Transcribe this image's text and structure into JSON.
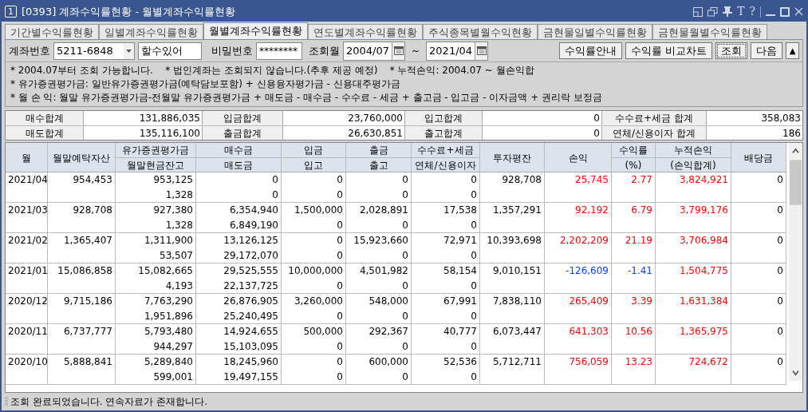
{
  "window": {
    "badge": "1",
    "title": "[0393] 계좌수익률현황 - 월별계좌수익률현황",
    "tool_glyphs": [
      "T",
      "?"
    ]
  },
  "tabs": [
    {
      "label": "기간별수익률현황",
      "selected": false
    },
    {
      "label": "일별계좌수익률현황",
      "selected": false
    },
    {
      "label": "월별계좌수익률현황",
      "selected": true
    },
    {
      "label": "연도별계좌수익률현황",
      "selected": false
    },
    {
      "label": "주식종목별월수익현황",
      "selected": false
    },
    {
      "label": "금현물일별수익률현황",
      "selected": false
    },
    {
      "label": "금현물월별수익률현황",
      "selected": false
    }
  ],
  "query": {
    "account_label": "계좌번호",
    "account": "5211-6848",
    "account_name": "할수있어",
    "password_label": "비밀번호",
    "password": "********",
    "period_label": "조회월",
    "from": "2004/07",
    "separator": "~",
    "to": "2021/04",
    "buttons": [
      {
        "label": "수익률안내",
        "focused": false
      },
      {
        "label": "수익률 비교차트",
        "focused": false
      },
      {
        "label": "조회",
        "focused": true
      },
      {
        "label": "다음",
        "focused": false
      }
    ],
    "collapse": "▲"
  },
  "notes": [
    "* 2004.07부터 조회 가능합니다.    * 법인계좌는 조회되지 않습니다.(추후 제공 예정)    * 누적손익: 2004.07 ~ 월손익합",
    "* 유가증권평가금: 일반유가증권평가금(예탁담보포함) + 신용융자평가금 - 신용대주평가금",
    "* 월 손 익: 월말 유가증권평가금-전월말 유가증권평가금 + 매도금 - 매수금 - 수수료 - 세금 + 출고금 - 입고금 - 이자금액 + 권리락 보정금"
  ],
  "summary": [
    [
      {
        "label": "매수합계",
        "value": "131,886,035"
      },
      {
        "label": "입금합계",
        "value": "23,760,000"
      },
      {
        "label": "입고합계",
        "value": "0"
      },
      {
        "label": "수수료+세금 합계",
        "value": "358,083"
      }
    ],
    [
      {
        "label": "매도합계",
        "value": "135,116,100"
      },
      {
        "label": "출금합계",
        "value": "26,630,851"
      },
      {
        "label": "출고합계",
        "value": "0"
      },
      {
        "label": "연체/신용이자 합계",
        "value": "186"
      }
    ]
  ],
  "table": {
    "columns": [
      {
        "top": "월"
      },
      {
        "top": "월말예탁자산"
      },
      {
        "top": "유가증권평가금",
        "bottom": "월말현금잔고"
      },
      {
        "top": "매수금",
        "bottom": "매도금"
      },
      {
        "top": "입금",
        "bottom": "입고"
      },
      {
        "top": "출금",
        "bottom": "출고"
      },
      {
        "top": "수수료+세금",
        "bottom": "연체/신용이자"
      },
      {
        "top": "투자평잔"
      },
      {
        "top": "손익"
      },
      {
        "top": "수익률",
        "bottom": "(%)"
      },
      {
        "top": "누적손익",
        "bottom": "(손익합계)"
      },
      {
        "top": "배당금"
      }
    ],
    "rows": [
      {
        "month": "2021/04",
        "assets": "954,453",
        "securities": "953,125",
        "cash": "1,328",
        "buy": "0",
        "sell": "0",
        "deposit": "0",
        "stock_in": "0",
        "withdrawal": "0",
        "stock_out": "0",
        "fee_tax": "0",
        "interest": "0",
        "avg_investment": "928,708",
        "profit": "25,745",
        "rate": "2.77",
        "cumulative": "3,824,921",
        "dividend": "0",
        "color": "#ff0000"
      },
      {
        "month": "2021/03",
        "assets": "928,708",
        "securities": "927,380",
        "cash": "1,328",
        "buy": "6,354,940",
        "sell": "6,849,190",
        "deposit": "1,500,000",
        "stock_in": "0",
        "withdrawal": "2,028,891",
        "stock_out": "0",
        "fee_tax": "17,538",
        "interest": "0",
        "avg_investment": "1,357,291",
        "profit": "92,192",
        "rate": "6.79",
        "cumulative": "3,799,176",
        "dividend": "0",
        "color": "#ff0000"
      },
      {
        "month": "2021/02",
        "assets": "1,365,407",
        "securities": "1,311,900",
        "cash": "53,507",
        "buy": "13,126,125",
        "sell": "29,172,070",
        "deposit": "0",
        "stock_in": "0",
        "withdrawal": "15,923,660",
        "stock_out": "0",
        "fee_tax": "72,971",
        "interest": "0",
        "avg_investment": "10,393,698",
        "profit": "2,202,209",
        "rate": "21.19",
        "cumulative": "3,706,984",
        "dividend": "0",
        "color": "#ff0000"
      },
      {
        "month": "2021/01",
        "assets": "15,086,858",
        "securities": "15,082,665",
        "cash": "4,193",
        "buy": "29,525,555",
        "sell": "22,137,725",
        "deposit": "10,000,000",
        "stock_in": "0",
        "withdrawal": "4,501,982",
        "stock_out": "0",
        "fee_tax": "58,154",
        "interest": "0",
        "avg_investment": "9,010,151",
        "profit": "-126,609",
        "rate": "-1.41",
        "cumulative": "1,504,775",
        "dividend": "0",
        "color": "#0040ff"
      },
      {
        "month": "2020/12",
        "assets": "9,715,186",
        "securities": "7,763,290",
        "cash": "1,951,896",
        "buy": "26,876,905",
        "sell": "25,240,495",
        "deposit": "3,260,000",
        "stock_in": "0",
        "withdrawal": "548,000",
        "stock_out": "0",
        "fee_tax": "67,991",
        "interest": "0",
        "avg_investment": "7,838,110",
        "profit": "265,409",
        "rate": "3.39",
        "cumulative": "1,631,384",
        "dividend": "0",
        "color": "#ff0000"
      },
      {
        "month": "2020/11",
        "assets": "6,737,777",
        "securities": "5,793,480",
        "cash": "944,297",
        "buy": "14,924,655",
        "sell": "15,103,095",
        "deposit": "500,000",
        "stock_in": "0",
        "withdrawal": "292,367",
        "stock_out": "0",
        "fee_tax": "40,777",
        "interest": "0",
        "avg_investment": "6,073,447",
        "profit": "641,303",
        "rate": "10.56",
        "cumulative": "1,365,975",
        "dividend": "0",
        "color": "#ff0000"
      },
      {
        "month": "2020/10",
        "assets": "5,888,841",
        "securities": "5,289,840",
        "cash": "599,001",
        "buy": "18,245,960",
        "sell": "19,497,155",
        "deposit": "0",
        "stock_in": "0",
        "withdrawal": "600,000",
        "stock_out": "0",
        "fee_tax": "52,536",
        "interest": "0",
        "avg_investment": "5,712,711",
        "profit": "756,059",
        "rate": "13.23",
        "cumulative": "724,672",
        "dividend": "0",
        "color": "#ff0000"
      }
    ]
  },
  "status_bar": "조회 완료되었습니다. 연속자료가 존재합니다."
}
